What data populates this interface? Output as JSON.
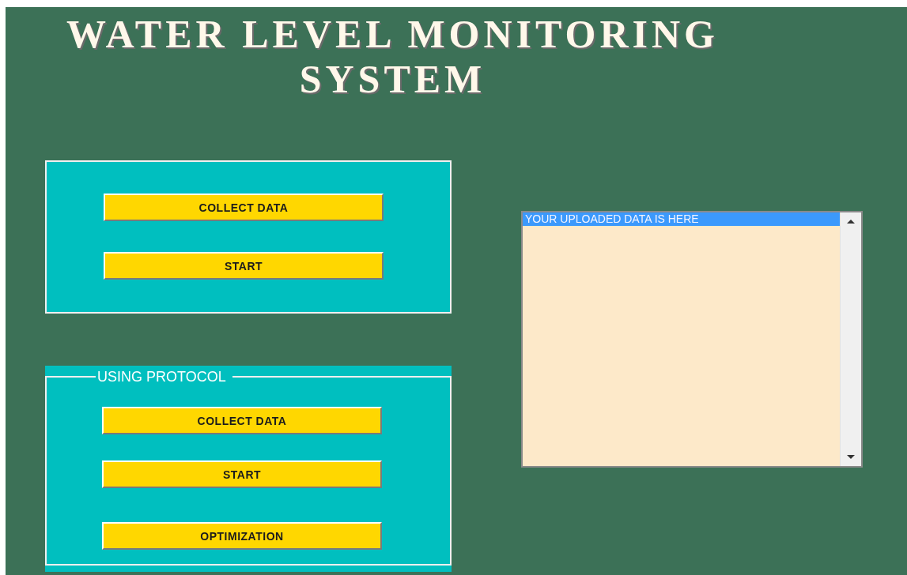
{
  "title": "WATER LEVEL MONITORING SYSTEM",
  "panels": [
    {
      "buttons": [
        "COLLECT DATA",
        "START"
      ]
    },
    {
      "legend": "USING PROTOCOL",
      "buttons": [
        "COLLECT DATA",
        "START",
        "OPTIMIZATION"
      ]
    }
  ],
  "listbox": {
    "items": [
      {
        "text": "YOUR UPLOADED DATA IS HERE",
        "selected": true
      }
    ]
  }
}
